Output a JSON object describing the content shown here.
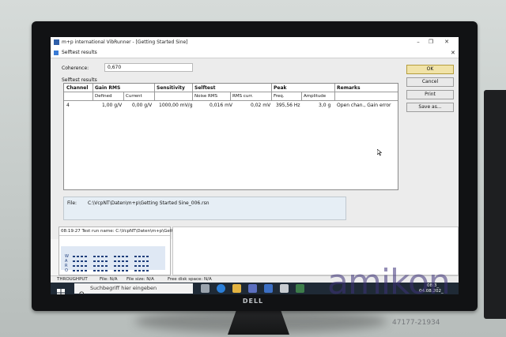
{
  "app": {
    "title": "m+p international VibRunner - [Getting Started Sine]",
    "min_glyph": "–",
    "max_glyph": "❐",
    "close_glyph": "✕"
  },
  "dialog": {
    "title": "Selftest results",
    "close_glyph": "✕",
    "coherence_label": "Coherence:",
    "coherence_value": "0,670",
    "results_label": "Selftest results",
    "buttons": {
      "ok": "OK",
      "cancel": "Cancel",
      "print": "Print",
      "save_as": "Save as..."
    },
    "table": {
      "headers": {
        "channel": "Channel",
        "gain_rms": "Gain RMS",
        "sensitivity": "Sensitivity",
        "selftest": "Selftest",
        "peak": "Peak",
        "remarks": "Remarks"
      },
      "subheaders": {
        "defined": "Defined",
        "current": "Current",
        "noise_rms": "Noise RMS",
        "rms_curr": "RMS curr.",
        "freq": "Freq.",
        "amplitude": "Amplitude"
      },
      "rows": [
        {
          "channel": "4",
          "defined": "1,00 g/V",
          "current": "0,00 g/V",
          "sensitivity": "1000,00 mV/g",
          "noise_rms": "0,016 mV",
          "rms_curr": "0,02 mV",
          "freq": "395,56 Hz",
          "amplitude": "3,0 g",
          "remarks": "Open chan., Gain error"
        }
      ]
    },
    "file_label": "File:",
    "file_path": "C:\\VcpNT\\Daten\\m+p\\Getting Started Sine_006.rsn"
  },
  "log": {
    "line1": "08:19:27 Test run name: C:\\VcpNT\\Daten\\m+p\\Gettı",
    "matrix_letters": [
      "W",
      "A",
      "R",
      "O"
    ]
  },
  "statusbar": {
    "throughput": "THROUGHPUT",
    "file": "File: N/A",
    "file_size": "File size: N/A",
    "free_disk": "Free disk space: N/A"
  },
  "taskbar": {
    "search_placeholder": "Suchbegriff hier eingeben",
    "time": "08:3_",
    "date": "04.08.202_"
  },
  "monitor": {
    "brand": "DELL"
  },
  "watermark": {
    "logo": "amikon",
    "id": "47177-21934"
  },
  "colors": {
    "ok_button": "#f1e3a8",
    "taskbar": "#1f2a36",
    "accent": "#2f5fa8"
  }
}
